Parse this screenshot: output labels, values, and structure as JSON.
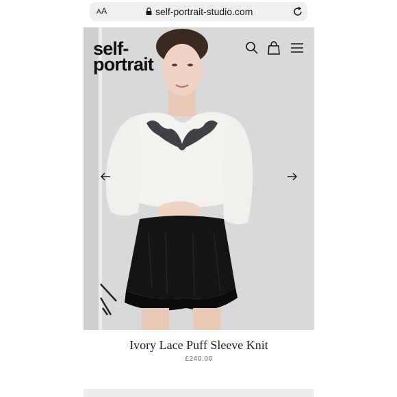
{
  "browser": {
    "aa_label_small": "A",
    "aa_label_large": "A",
    "url": "self-portrait-studio.com"
  },
  "header": {
    "logo_line1": "self-",
    "logo_line2": "portrait"
  },
  "icons": {
    "lock": "lock-icon",
    "reload": "reload-icon",
    "search": "search-icon",
    "bag": "shopping-bag-icon",
    "menu": "hamburger-menu-icon",
    "prev": "arrow-left-icon",
    "next": "arrow-right-icon"
  },
  "product": {
    "name": "Ivory Lace Puff Sleeve Knit",
    "price": "£240.00"
  },
  "colors": {
    "text": "#111111",
    "hero_bg": "#d8d8d8",
    "knit": "#f4f2ee",
    "shorts": "#111111"
  }
}
